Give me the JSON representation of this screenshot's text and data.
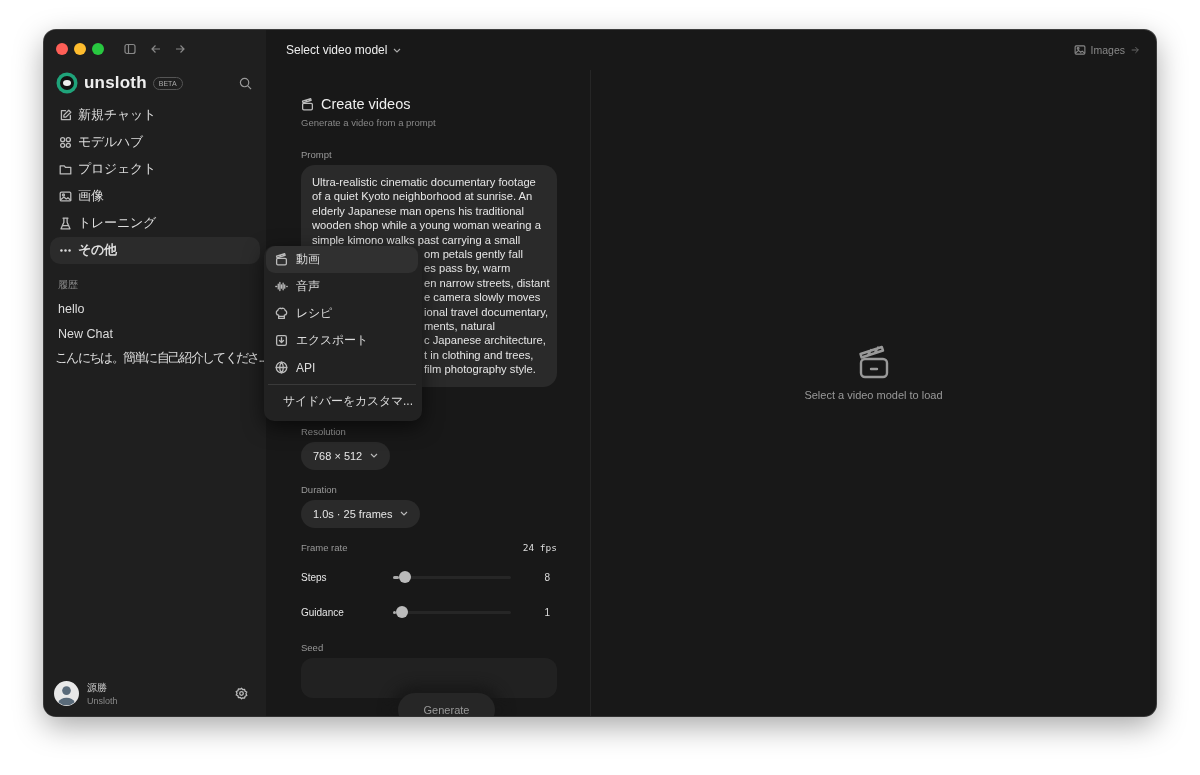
{
  "sidebar": {
    "brand": "unsloth",
    "badge": "BETA",
    "nav": [
      {
        "label": "新規チャット",
        "selected": false
      },
      {
        "label": "モデルハブ",
        "selected": false
      },
      {
        "label": "プロジェクト",
        "selected": false
      },
      {
        "label": "画像",
        "selected": false
      },
      {
        "label": "トレーニング",
        "selected": false
      },
      {
        "label": "その他",
        "selected": true
      }
    ],
    "history_heading": "履歴",
    "history": [
      {
        "label": "hello"
      },
      {
        "label": "New Chat"
      },
      {
        "label": "こんにちは。簡単に自己紹介してくださ..."
      }
    ],
    "user": {
      "name": "源勝",
      "org": "Unsloth"
    }
  },
  "menu": {
    "items": [
      {
        "label": "動画",
        "selected": true
      },
      {
        "label": "音声",
        "selected": false
      },
      {
        "label": "レシピ",
        "selected": false
      },
      {
        "label": "エクスポート",
        "selected": false
      },
      {
        "label": "API",
        "selected": false
      }
    ],
    "footer": "サイドバーをカスタマ..."
  },
  "topbar": {
    "model_select": "Select video model",
    "images_link": "Images"
  },
  "form": {
    "title": "Create videos",
    "subtitle": "Generate a video from a prompt",
    "prompt_label": "Prompt",
    "prompt_lines": [
      "Ultra-realistic cinematic documentary footage",
      "of a quiet Kyoto neighborhood at sunrise. An",
      "elderly Japanese man opens his traditional",
      "wooden shop while a young woman wearing a",
      "simple kimono walks past carrying a small"
    ],
    "prompt_covered_lines": [
      "om petals gently fall",
      "es pass by, warm",
      "en narrow streets, distant",
      "e camera slowly moves",
      "ional travel documentary,",
      "ments, natural",
      "c Japanese architecture,",
      "t in clothing and trees,",
      "film photography style."
    ],
    "resolution_label": "Resolution",
    "resolution": "768 × 512",
    "duration_label": "Duration",
    "duration": "1.0s · 25 frames",
    "frame_rate_label": "Frame rate",
    "frame_rate": "24 fps",
    "sliders": [
      {
        "label": "Steps",
        "level": 0.1,
        "reading": "8"
      },
      {
        "label": "Guidance",
        "level": 0.08,
        "reading": "1"
      }
    ],
    "seed_label": "Seed",
    "generate": "Generate"
  },
  "preview": {
    "message": "Select a video model to load"
  }
}
